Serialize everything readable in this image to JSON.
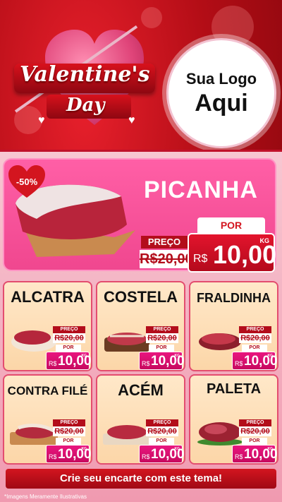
{
  "header": {
    "valentine_title": "Valentine's",
    "valentine_day": "Day",
    "logo_line1": "Sua Logo",
    "logo_line2": "Aqui"
  },
  "hero": {
    "discount": "-50%",
    "name": "PICANHA",
    "preco_label": "PREÇO",
    "old_price": "R$20,00",
    "por_label": "POR",
    "currency": "R$",
    "new_price": "10,00",
    "unit": "KG"
  },
  "products": [
    {
      "name": "ALCATRA",
      "preco_label": "PREÇO",
      "old_price": "R$20,00",
      "por_label": "POR",
      "currency": "R$",
      "price": "10,00",
      "unit": "KG"
    },
    {
      "name": "COSTELA",
      "preco_label": "PREÇO",
      "old_price": "R$20,00",
      "por_label": "POR",
      "currency": "R$",
      "price": "10,00",
      "unit": "KG"
    },
    {
      "name": "FRALDINHA",
      "preco_label": "PREÇO",
      "old_price": "R$20,00",
      "por_label": "POR",
      "currency": "R$",
      "price": "10,00",
      "unit": "KG"
    },
    {
      "name": "CONTRA FILÉ",
      "preco_label": "PREÇO",
      "old_price": "R$20,00",
      "por_label": "POR",
      "currency": "R$",
      "price": "10,00",
      "unit": "KG"
    },
    {
      "name": "ACÉM",
      "preco_label": "PREÇO",
      "old_price": "R$20,00",
      "por_label": "POR",
      "currency": "R$",
      "price": "10,00",
      "unit": "KG"
    },
    {
      "name": "PALETA",
      "preco_label": "PREÇO",
      "old_price": "R$20,00",
      "por_label": "POR",
      "currency": "R$",
      "price": "10,00",
      "unit": "KG"
    }
  ],
  "footer": {
    "cta": "Crie seu encarte com este tema!",
    "note": "*Imagens Meramente Ilustrativas"
  },
  "colors": {
    "background_red": "#b30d16",
    "hero_pink": "#f0478f",
    "card_cream": "#ffe8c9",
    "price_red": "#d3151f"
  }
}
